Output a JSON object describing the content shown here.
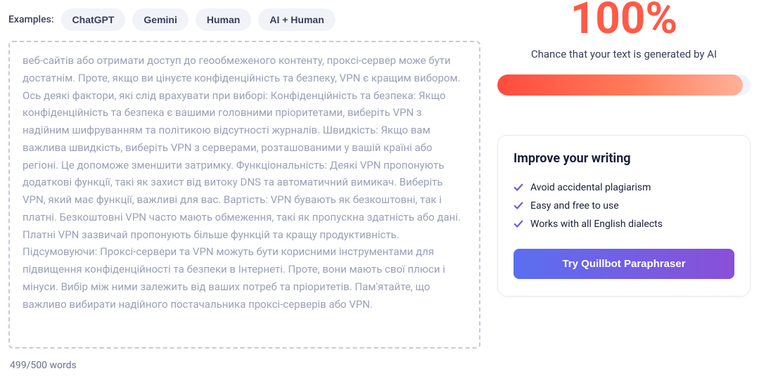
{
  "examples": {
    "label": "Examples:",
    "chips": [
      "ChatGPT",
      "Gemini",
      "Human",
      "AI + Human"
    ]
  },
  "textContent": "веб-сайтів або отримати доступ до геообмеженого контенту, проксі-сервер може бути достатнім. Проте, якщо ви цінуєте конфіденційність та безпеку, VPN є кращим вибором. Ось деякі фактори, які слід врахувати при виборі: Конфіденційність та безпека: Якщо конфіденційність та безпека є вашими головними пріоритетами, виберіть VPN з надійним шифруванням та політикою відсутності журналів. Швидкість: Якщо вам важлива швидкість, виберіть VPN з серверами, розташованими у вашій країні або регіоні. Це допоможе зменшити затримку. Функціональність: Деякі VPN пропонують додаткові функції, такі як захист від витоку DNS та автоматичний вимикач. Виберіть VPN, який має функції, важливі для вас. Вартість: VPN бувають як безкоштовні, так і платні. Безкоштовні VPN часто мають обмеження, такі як пропускна здатність або дані. Платні VPN зазвичай пропонують більше функцій та кращу продуктивність. Підсумовуючи: Проксі-сервери та VPN можуть бути корисними інструментами для підвищення конфіденційності та безпеки в Інтернеті. Проте, вони мають свої плюси і мінуси. Вибір між ними залежить від ваших потреб та пріоритетів. Пам'ятайте, що важливо вибирати надійного постачальника проксі-серверів або VPN.",
  "wordCount": "499/500 words",
  "result": {
    "percentage": "100%",
    "label": "Chance that your text is generated by AI"
  },
  "card": {
    "title": "Improve your writing",
    "features": [
      "Avoid accidental plagiarism",
      "Easy and free to use",
      "Works with all English dialects"
    ],
    "ctaLabel": "Try Quillbot Paraphraser"
  },
  "colors": {
    "accentRed": "#ff5a47",
    "checkPurple": "#6a5ae0"
  }
}
